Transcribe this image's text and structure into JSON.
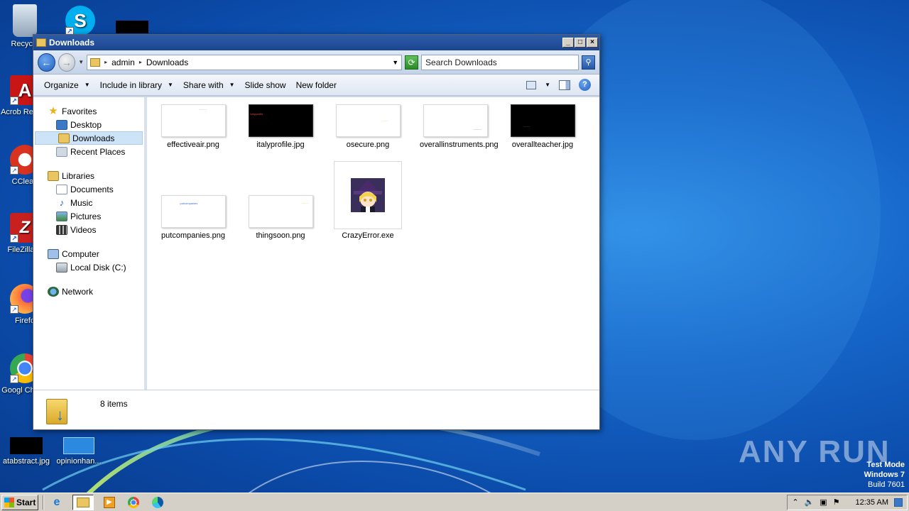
{
  "desktop": {
    "icons": [
      {
        "label": "Recycle",
        "name": "recycle-bin"
      },
      {
        "label": "Acrob Reader",
        "name": "acrobat-reader"
      },
      {
        "label": "CClean",
        "name": "ccleaner"
      },
      {
        "label": "FileZilla C",
        "name": "filezilla"
      },
      {
        "label": "Firefo",
        "name": "firefox"
      },
      {
        "label": "Googl Chrom",
        "name": "google-chrome"
      },
      {
        "label": "atabstract.jpg",
        "name": "atabstract-file"
      },
      {
        "label": "opinionhan...",
        "name": "opinionhan-file"
      }
    ]
  },
  "window": {
    "title": "Downloads",
    "breadcrumb": [
      "admin",
      "Downloads"
    ],
    "search_placeholder": "Search Downloads",
    "toolbar": {
      "organize": "Organize",
      "include_in_library": "Include in library",
      "share_with": "Share with",
      "slide_show": "Slide show",
      "new_folder": "New folder"
    },
    "nav": {
      "favorites": "Favorites",
      "desktop": "Desktop",
      "downloads": "Downloads",
      "recent_places": "Recent Places",
      "libraries": "Libraries",
      "documents": "Documents",
      "music": "Music",
      "pictures": "Pictures",
      "videos": "Videos",
      "computer": "Computer",
      "local_disk": "Local Disk (C:)",
      "network": "Network"
    },
    "files": [
      {
        "name": "effectiveair.png",
        "thumb": "white"
      },
      {
        "name": "italyprofile.jpg",
        "thumb": "black"
      },
      {
        "name": "osecure.png",
        "thumb": "white"
      },
      {
        "name": "overallinstruments.png",
        "thumb": "white"
      },
      {
        "name": "overallteacher.jpg",
        "thumb": "black"
      },
      {
        "name": "putcompanies.png",
        "thumb": "white"
      },
      {
        "name": "thingsoon.png",
        "thumb": "white"
      },
      {
        "name": "CrazyError.exe",
        "thumb": "exe"
      }
    ],
    "thumb_text": {
      "italyprofile": "italyprofile",
      "putcompanies": "putcompanies"
    },
    "status": "8 items"
  },
  "overlay": {
    "watermark": "ANY RUN",
    "test_mode": "Test Mode",
    "os": "Windows 7",
    "build": "Build 7601"
  },
  "taskbar": {
    "start": "Start",
    "clock": "12:35 AM"
  },
  "colors": {
    "titlebar": "#1c4591",
    "selection": "#cde3f7",
    "desktop": "#1565c8"
  }
}
